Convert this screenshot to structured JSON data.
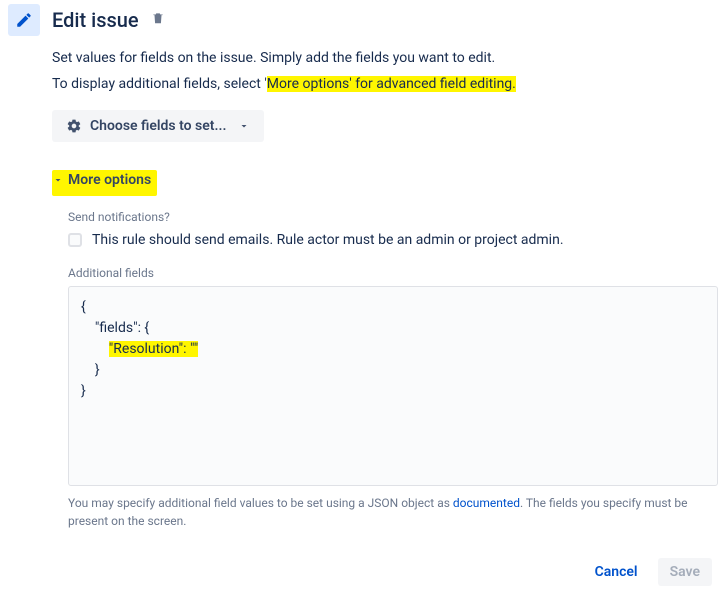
{
  "header": {
    "title": "Edit issue"
  },
  "desc": {
    "line1": "Set values for fields on the issue. Simply add the fields you want to edit.",
    "line2_prefix": "To display additional fields, select '",
    "line2_hl": "More options' for advanced field editing.",
    "choose_fields_label": "Choose fields to set..."
  },
  "more": {
    "toggle_label": "More options",
    "send_notifications_label": "Send notifications?",
    "checkbox_text": "This rule should send emails. Rule actor must be an admin or project admin.",
    "additional_fields_label": "Additional fields",
    "json_l1": "{",
    "json_l2": "    \"fields\": {",
    "json_l3_hl": "\"Resolution\": \"\"",
    "json_l3_indent": "        ",
    "json_l4": "    }",
    "json_l5": "}",
    "help_before": "You may specify additional field values to be set using a JSON object as ",
    "help_link": "documented",
    "help_after": ". The fields you specify must be present on the screen."
  },
  "footer": {
    "cancel": "Cancel",
    "save": "Save"
  }
}
